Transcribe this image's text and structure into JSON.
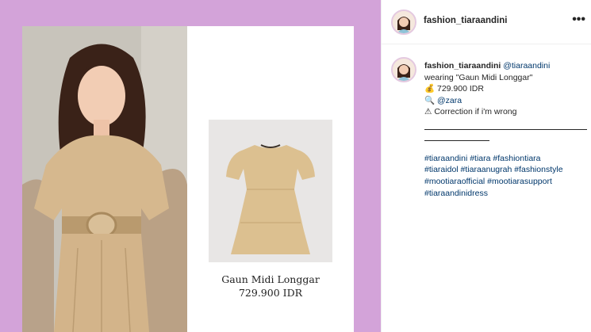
{
  "post": {
    "product_name": "Gaun Midi Longgar",
    "product_price": "729.900 IDR"
  },
  "header": {
    "username": "fashion_tiaraandini",
    "more_label": "•••"
  },
  "caption": {
    "username": "fashion_tiaraandini",
    "mention": "@tiaraandini",
    "line1": "wearing \"Gaun Midi Longgar\"",
    "price_emoji": "💰",
    "price": "729.900 IDR",
    "search_emoji": "🔍",
    "brand": "@zara",
    "warn_emoji": "⚠",
    "warn_text": "Correction if i'm wrong",
    "hashtags": [
      "#tiaraandini #tiara #fashiontiara",
      "#tiaraidol #tiaraanugrah #fashionstyle",
      "#mootiaraofficial #mootiarasupport",
      "#tiaraandinidress"
    ]
  },
  "colors": {
    "background": "#d3a3d9",
    "link": "#00376b",
    "text": "#262626"
  }
}
